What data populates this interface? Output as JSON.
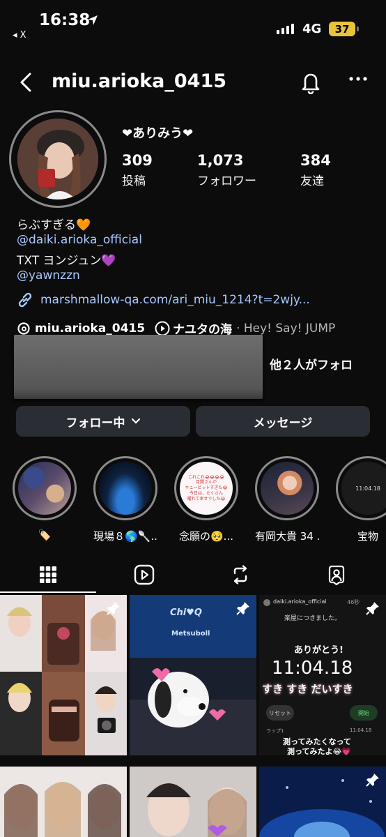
{
  "status_bar": {
    "time": "16:38",
    "back_app": "◂ X",
    "network": "4G",
    "battery": "37"
  },
  "header": {
    "username": "miu.arioka_0415"
  },
  "profile": {
    "display_name": "❤ありみう❤",
    "stats": [
      {
        "value": "309",
        "label": "投稿"
      },
      {
        "value": "1,073",
        "label": "フォロワー"
      },
      {
        "value": "384",
        "label": "友達"
      }
    ],
    "bio": {
      "line1": "らぶすぎる",
      "line1_emoji": "🧡",
      "mention1": "@daiki.arioka_official",
      "line3": "TXT ヨンジュン",
      "line3_emoji": "💜",
      "mention2": "@yawnzzn",
      "link": "marshmallow-qa.com/ari_miu_1214?t=2wjy..."
    },
    "threads_handle": "miu.arioka_0415",
    "music_title": "ナユタの海",
    "music_artist": "· Hey! Say! JUMP",
    "followed_by": "、他２人がフォロ"
  },
  "buttons": {
    "following": "フォロー中",
    "message": "メッセージ"
  },
  "highlights": [
    {
      "caption": "🏷️"
    },
    {
      "caption": "現場８🌎🥄..."
    },
    {
      "caption": "念願の🥺..."
    },
    {
      "caption": "有岡大貴 34 ..."
    },
    {
      "caption": "宝物"
    }
  ],
  "highlight_texts": {
    "h3_line1": "これこれ😂😂😂😂",
    "h3_line2": "月間さんが",
    "h3_line3": "キュービットすぎた😂",
    "h3_line4": "今日は、たくさん",
    "h3_line5": "曜れて幸せでした😂",
    "h5_time": "11:04.18"
  },
  "grid": {
    "tile2_banner": "Chi♥Q",
    "tile2_sub": "Metsuboll",
    "tile3_user": "daiki.arioka_official",
    "tile3_age": "46秒",
    "tile3_text": "楽屋につきました。",
    "tile3_thanks": "ありがとう!",
    "tile3_time": "11:04.18",
    "tile3_sticker": "すき すき だいすき",
    "tile3_reset": "リセット",
    "tile3_start": "開始",
    "tile3_lap": "ラップ1",
    "tile3_lap_time": "11:04.18",
    "tile3_caption1": "測ってみたくなって",
    "tile3_caption2": "測ってみたよ😂💗"
  },
  "colors": {
    "background": "#0c0c0c",
    "button": "#2a2d33",
    "link": "#a8c8ff",
    "battery": "#e8c43a"
  }
}
